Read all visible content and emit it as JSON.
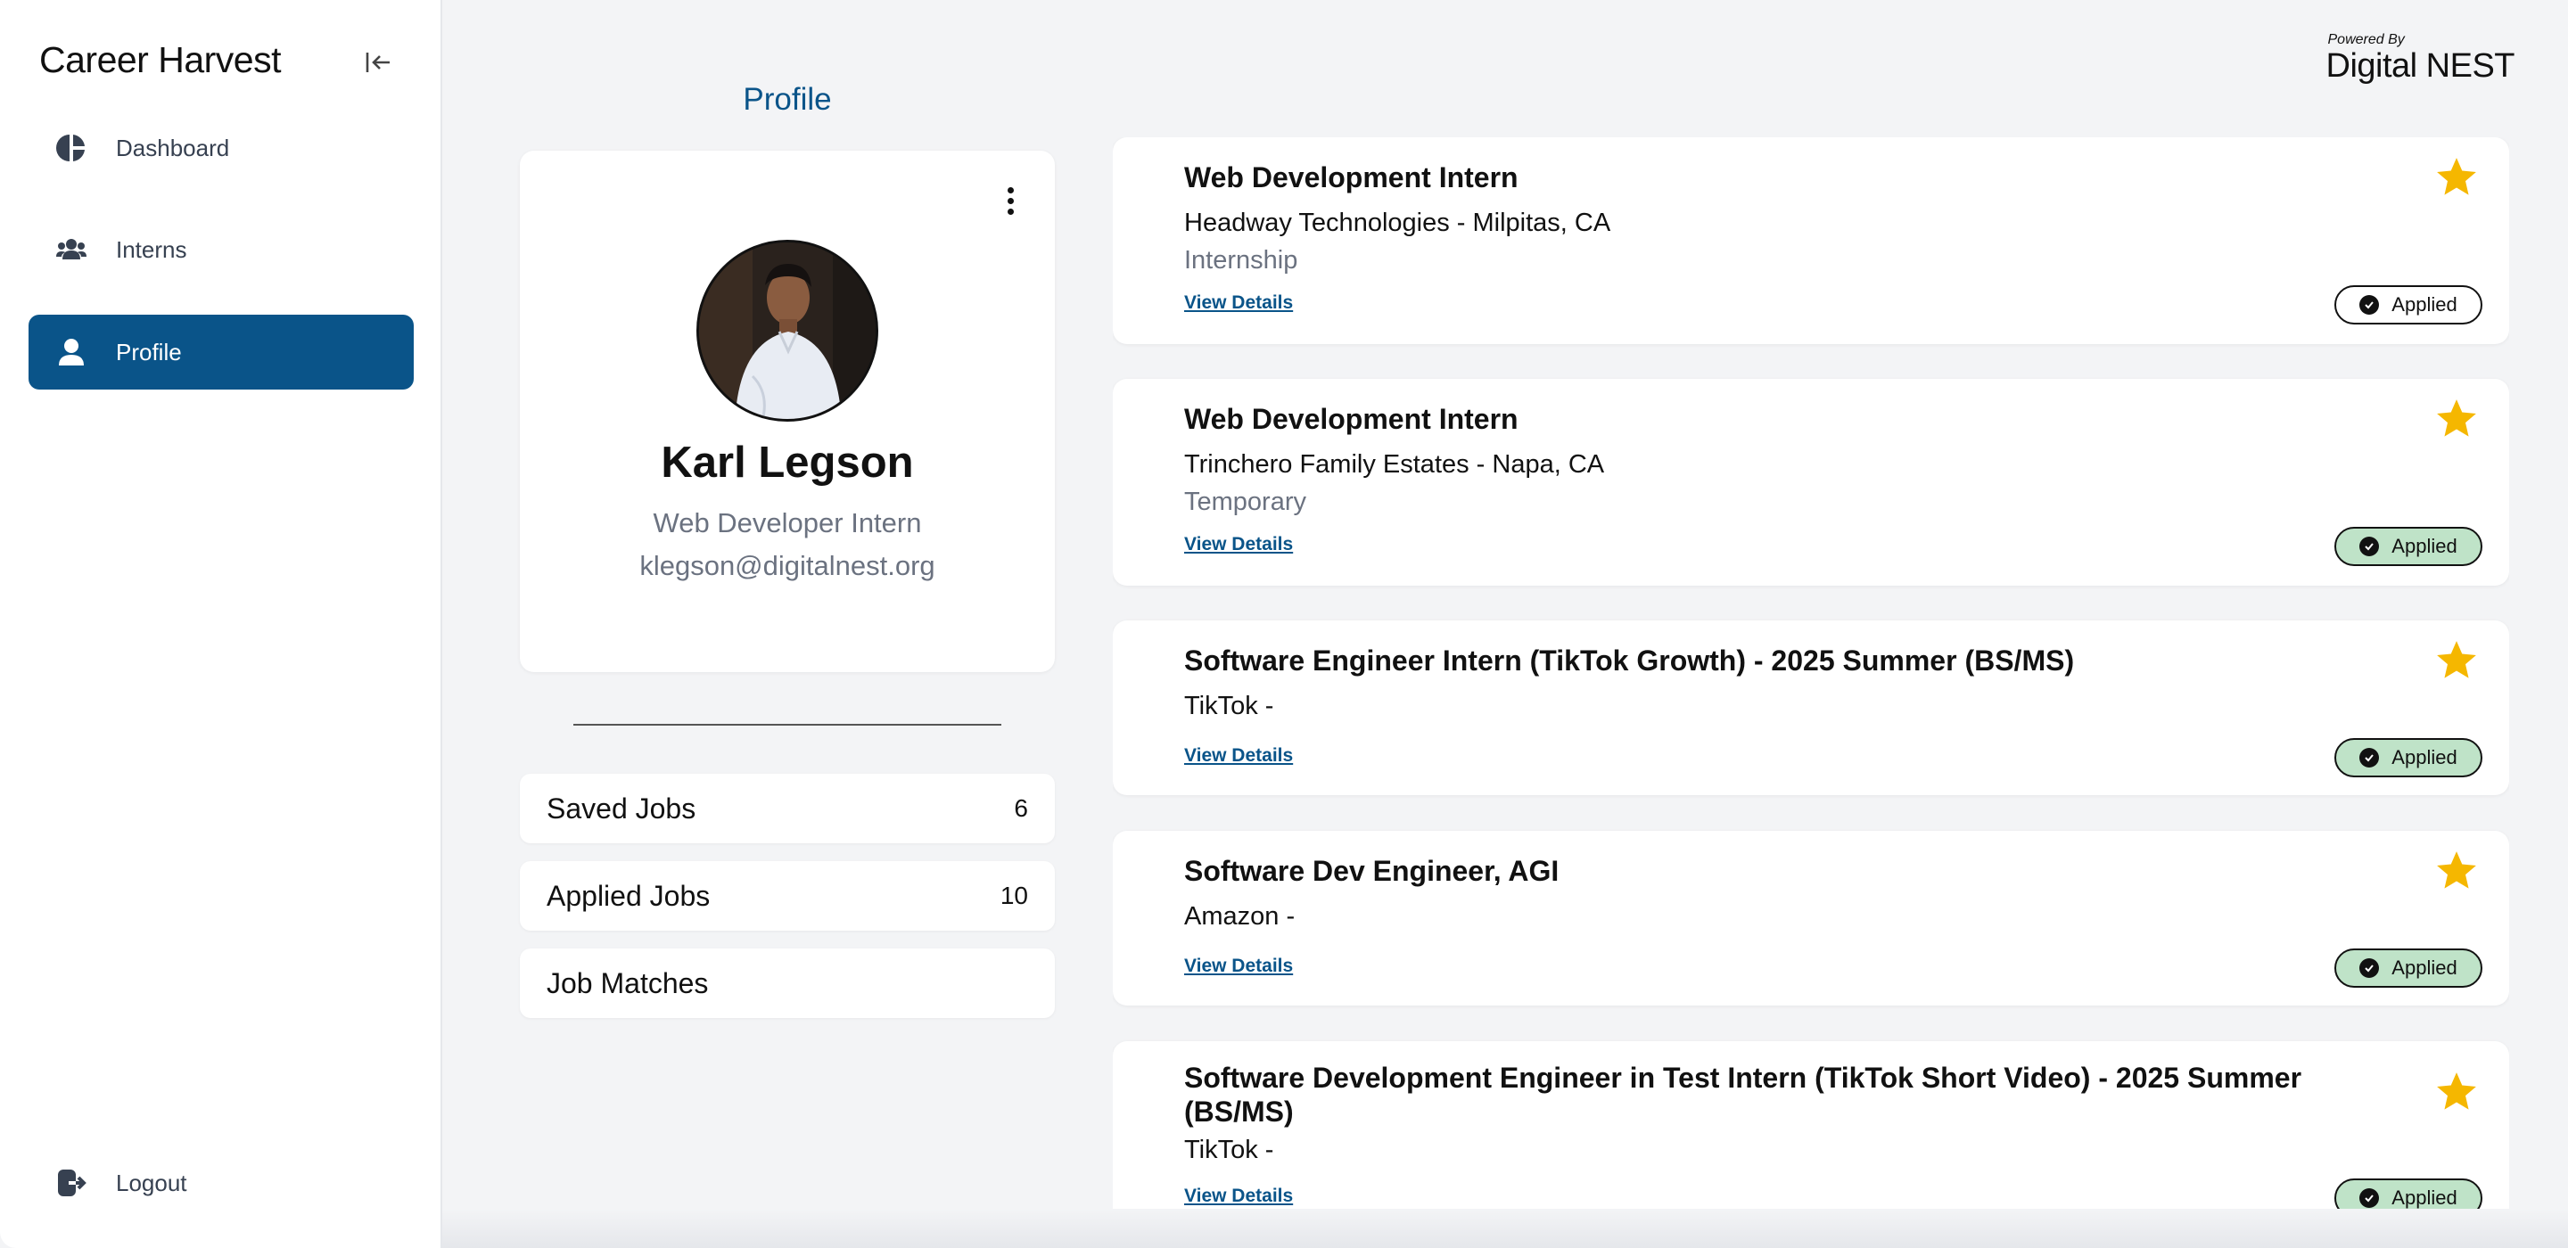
{
  "app": {
    "title": "Career Harvest"
  },
  "sidebar": {
    "items": [
      {
        "label": "Dashboard",
        "icon": "dashboard-icon"
      },
      {
        "label": "Interns",
        "icon": "users-icon"
      },
      {
        "label": "Profile",
        "icon": "user-icon",
        "active": true
      }
    ],
    "logout_label": "Logout"
  },
  "branding": {
    "powered_by": "Powered By",
    "brand": "Digital NEST"
  },
  "profile": {
    "section_title": "Profile",
    "name": "Karl Legson",
    "role": "Web Developer Intern",
    "email": "klegson@digitalnest.org",
    "stats": [
      {
        "label": "Saved Jobs",
        "count": "6"
      },
      {
        "label": "Applied Jobs",
        "count": "10"
      },
      {
        "label": "Job Matches",
        "count": ""
      }
    ]
  },
  "jobs": [
    {
      "title": "Web Development Intern",
      "company": "Headway Technologies - Milpitas, CA",
      "type": "Internship",
      "link": "View Details",
      "status": "Applied",
      "starred": true
    },
    {
      "title": "Web Development Intern",
      "company": "Trinchero Family Estates - Napa, CA",
      "type": "Temporary",
      "link": "View Details",
      "status": "Applied",
      "starred": true
    },
    {
      "title": "Software Engineer Intern (TikTok Growth) - 2025 Summer (BS/MS)",
      "company": "TikTok -",
      "type": "",
      "link": "View Details",
      "status": "Applied",
      "starred": true
    },
    {
      "title": "Software Dev Engineer, AGI",
      "company": "Amazon -",
      "type": "",
      "link": "View Details",
      "status": "Applied",
      "starred": true
    },
    {
      "title": "Software Development Engineer in Test Intern (TikTok Short Video) - 2025 Summer (BS/MS)",
      "company": "TikTok -",
      "type": "",
      "link": "View Details",
      "status": "Applied",
      "starred": true
    }
  ],
  "colors": {
    "primary": "#0a5489",
    "star": "#f5b700",
    "applied_green": "#bfe3c8",
    "background": "#f3f4f6"
  }
}
